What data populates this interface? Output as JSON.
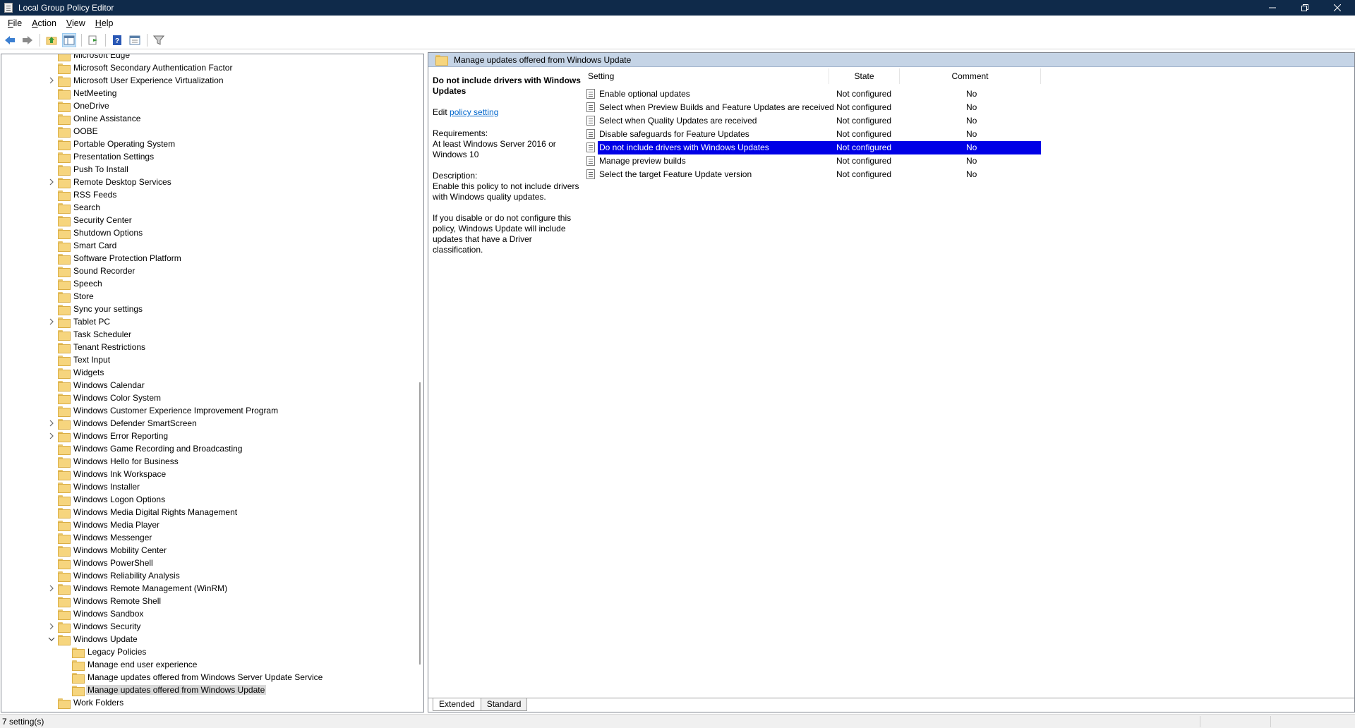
{
  "window": {
    "title": "Local Group Policy Editor",
    "controls": [
      "minimize-icon",
      "restore-icon",
      "close-icon"
    ]
  },
  "menubar": {
    "items": [
      {
        "label": "File"
      },
      {
        "label": "Action"
      },
      {
        "label": "View"
      },
      {
        "label": "Help"
      }
    ]
  },
  "toolbar": {
    "buttons": [
      "back-arrow-icon",
      "forward-arrow-icon",
      "up-folder-icon",
      "show-hide-tree-icon",
      "export-list-icon",
      "help-icon",
      "properties-icon",
      "filter-icon"
    ]
  },
  "tree": {
    "items": [
      {
        "label": "Microsoft Edge",
        "expandable": false
      },
      {
        "label": "Microsoft Secondary Authentication Factor",
        "expandable": false
      },
      {
        "label": "Microsoft User Experience Virtualization",
        "expandable": true
      },
      {
        "label": "NetMeeting",
        "expandable": false
      },
      {
        "label": "OneDrive",
        "expandable": false
      },
      {
        "label": "Online Assistance",
        "expandable": false
      },
      {
        "label": "OOBE",
        "expandable": false
      },
      {
        "label": "Portable Operating System",
        "expandable": false
      },
      {
        "label": "Presentation Settings",
        "expandable": false
      },
      {
        "label": "Push To Install",
        "expandable": false
      },
      {
        "label": "Remote Desktop Services",
        "expandable": true
      },
      {
        "label": "RSS Feeds",
        "expandable": false
      },
      {
        "label": "Search",
        "expandable": false
      },
      {
        "label": "Security Center",
        "expandable": false
      },
      {
        "label": "Shutdown Options",
        "expandable": false
      },
      {
        "label": "Smart Card",
        "expandable": false
      },
      {
        "label": "Software Protection Platform",
        "expandable": false
      },
      {
        "label": "Sound Recorder",
        "expandable": false
      },
      {
        "label": "Speech",
        "expandable": false
      },
      {
        "label": "Store",
        "expandable": false
      },
      {
        "label": "Sync your settings",
        "expandable": false
      },
      {
        "label": "Tablet PC",
        "expandable": true
      },
      {
        "label": "Task Scheduler",
        "expandable": false
      },
      {
        "label": "Tenant Restrictions",
        "expandable": false
      },
      {
        "label": "Text Input",
        "expandable": false
      },
      {
        "label": "Widgets",
        "expandable": false
      },
      {
        "label": "Windows Calendar",
        "expandable": false
      },
      {
        "label": "Windows Color System",
        "expandable": false
      },
      {
        "label": "Windows Customer Experience Improvement Program",
        "expandable": false
      },
      {
        "label": "Windows Defender SmartScreen",
        "expandable": true
      },
      {
        "label": "Windows Error Reporting",
        "expandable": true
      },
      {
        "label": "Windows Game Recording and Broadcasting",
        "expandable": false
      },
      {
        "label": "Windows Hello for Business",
        "expandable": false
      },
      {
        "label": "Windows Ink Workspace",
        "expandable": false
      },
      {
        "label": "Windows Installer",
        "expandable": false
      },
      {
        "label": "Windows Logon Options",
        "expandable": false
      },
      {
        "label": "Windows Media Digital Rights Management",
        "expandable": false
      },
      {
        "label": "Windows Media Player",
        "expandable": false
      },
      {
        "label": "Windows Messenger",
        "expandable": false
      },
      {
        "label": "Windows Mobility Center",
        "expandable": false
      },
      {
        "label": "Windows PowerShell",
        "expandable": false
      },
      {
        "label": "Windows Reliability Analysis",
        "expandable": false
      },
      {
        "label": "Windows Remote Management (WinRM)",
        "expandable": true
      },
      {
        "label": "Windows Remote Shell",
        "expandable": false
      },
      {
        "label": "Windows Sandbox",
        "expandable": false
      },
      {
        "label": "Windows Security",
        "expandable": true
      },
      {
        "label": "Windows Update",
        "expandable": true,
        "expanded": true
      },
      {
        "label": "Legacy Policies",
        "expandable": false,
        "child": true
      },
      {
        "label": "Manage end user experience",
        "expandable": false,
        "child": true
      },
      {
        "label": "Manage updates offered from Windows Server Update Service",
        "expandable": false,
        "child": true
      },
      {
        "label": "Manage updates offered from Windows Update",
        "expandable": false,
        "child": true,
        "selected": true
      },
      {
        "label": "Work Folders",
        "expandable": false
      }
    ]
  },
  "right": {
    "header": "Manage updates offered from Windows Update",
    "description": {
      "title": "Do not include drivers with Windows Updates",
      "edit_prefix": "Edit ",
      "edit_link": "policy setting",
      "requirements_label": "Requirements:",
      "requirements_text": "At least Windows Server 2016 or Windows 10",
      "description_label": "Description:",
      "description_text": "Enable this policy to not include drivers with Windows quality updates.",
      "description_text2": "If you disable or do not configure this policy, Windows Update will include updates that have a Driver classification."
    },
    "columns": {
      "setting": "Setting",
      "state": "State",
      "comment": "Comment"
    },
    "rows": [
      {
        "setting": "Enable optional updates",
        "state": "Not configured",
        "comment": "No"
      },
      {
        "setting": "Select when Preview Builds and Feature Updates are received",
        "state": "Not configured",
        "comment": "No"
      },
      {
        "setting": "Select when Quality Updates are received",
        "state": "Not configured",
        "comment": "No"
      },
      {
        "setting": "Disable safeguards for Feature Updates",
        "state": "Not configured",
        "comment": "No"
      },
      {
        "setting": "Do not include drivers with Windows Updates",
        "state": "Not configured",
        "comment": "No",
        "selected": true
      },
      {
        "setting": "Manage preview builds",
        "state": "Not configured",
        "comment": "No"
      },
      {
        "setting": "Select the target Feature Update version",
        "state": "Not configured",
        "comment": "No"
      }
    ],
    "tabs": [
      {
        "label": "Extended",
        "active": true
      },
      {
        "label": "Standard",
        "active": false
      }
    ]
  },
  "statusbar": {
    "text": "7 setting(s)"
  },
  "colors": {
    "titlebar": "#0f2a4a",
    "header": "#c5d4e6",
    "selection": "#0000e6",
    "link": "#0066cc"
  }
}
